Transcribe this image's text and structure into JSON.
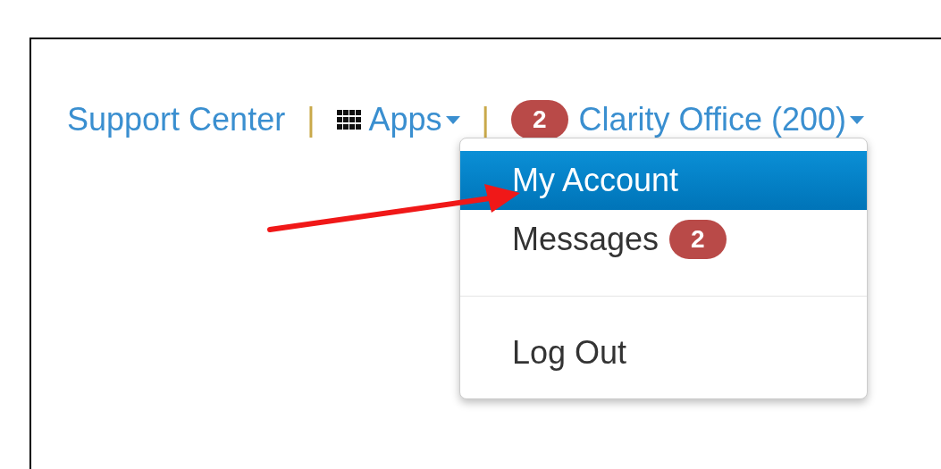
{
  "nav": [
    {
      "kind": "link",
      "label": "Support Center"
    },
    {
      "kind": "divider",
      "label": "|"
    },
    {
      "kind": "apps",
      "label": "Apps"
    },
    {
      "kind": "divider",
      "label": "|"
    }
  ],
  "account_menu": {
    "badge": "2",
    "label": "Clarity Office (200)",
    "expanded": true
  },
  "dropdown": [
    {
      "kind": "item",
      "label": "My Account",
      "selected": true
    },
    {
      "kind": "item",
      "label": "Messages",
      "badge": "2",
      "selected": false
    },
    {
      "kind": "divider"
    },
    {
      "kind": "item",
      "label": "Log Out",
      "selected": false
    }
  ]
}
